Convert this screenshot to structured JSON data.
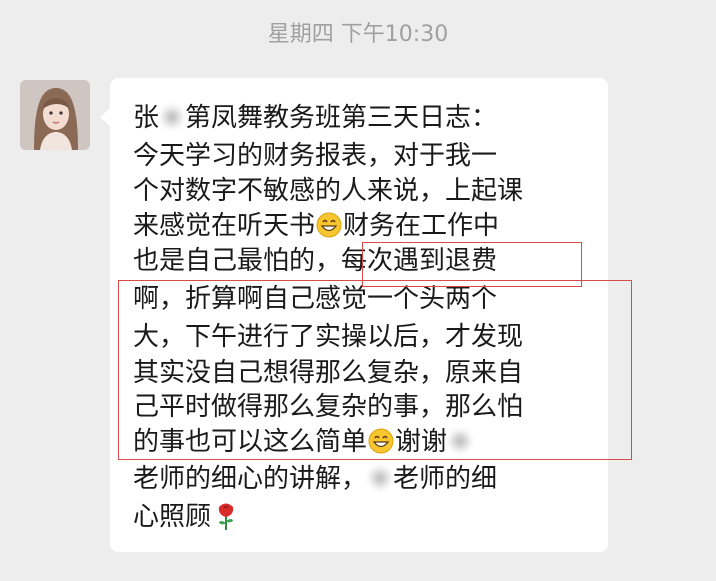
{
  "chat": {
    "timestamp": "星期四 下午10:30",
    "avatar_icon": "user-avatar",
    "message": {
      "lines": [
        {
          "segments": [
            {
              "t": "text",
              "v": "张"
            },
            {
              "t": "redacted"
            },
            {
              "t": "text",
              "v": "第凤舞教务班第三天日志："
            }
          ]
        },
        {
          "segments": [
            {
              "t": "text",
              "v": "  今天学习的财务报表，对于我一"
            }
          ]
        },
        {
          "segments": [
            {
              "t": "text",
              "v": "个对数字不敏感的人来说，上起课"
            }
          ]
        },
        {
          "segments": [
            {
              "t": "text",
              "v": "来感觉在听天书"
            },
            {
              "t": "emoji",
              "name": "grinning-face-emoji"
            },
            {
              "t": "text",
              "v": "财务在工作中"
            }
          ]
        },
        {
          "segments": [
            {
              "t": "text",
              "v": "也是自己最怕的，每次遇到退费"
            }
          ]
        },
        {
          "segments": [
            {
              "t": "text",
              "v": "啊，折算啊自己感觉一个头两个"
            }
          ]
        },
        {
          "segments": [
            {
              "t": "text",
              "v": "大，下午进行了实操以后，才发现"
            }
          ]
        },
        {
          "segments": [
            {
              "t": "text",
              "v": "其实没自己想得那么复杂，原来自"
            }
          ]
        },
        {
          "segments": [
            {
              "t": "text",
              "v": "己平时做得那么复杂的事，那么怕"
            }
          ]
        },
        {
          "segments": [
            {
              "t": "text",
              "v": "的事也可以这么简单"
            },
            {
              "t": "emoji",
              "name": "grinning-face-emoji"
            },
            {
              "t": "text",
              "v": "谢谢"
            },
            {
              "t": "redacted"
            }
          ]
        },
        {
          "segments": [
            {
              "t": "text",
              "v": "老师的细心的讲解，"
            },
            {
              "t": "redacted"
            },
            {
              "t": "text",
              "v": "老师的细"
            }
          ]
        },
        {
          "segments": [
            {
              "t": "text",
              "v": "心照顾"
            },
            {
              "t": "emoji",
              "name": "rose-emoji"
            }
          ]
        }
      ]
    },
    "annotation_color": "#d94a4a",
    "bubble_color": "#ffffff",
    "background_color": "#ededed"
  }
}
